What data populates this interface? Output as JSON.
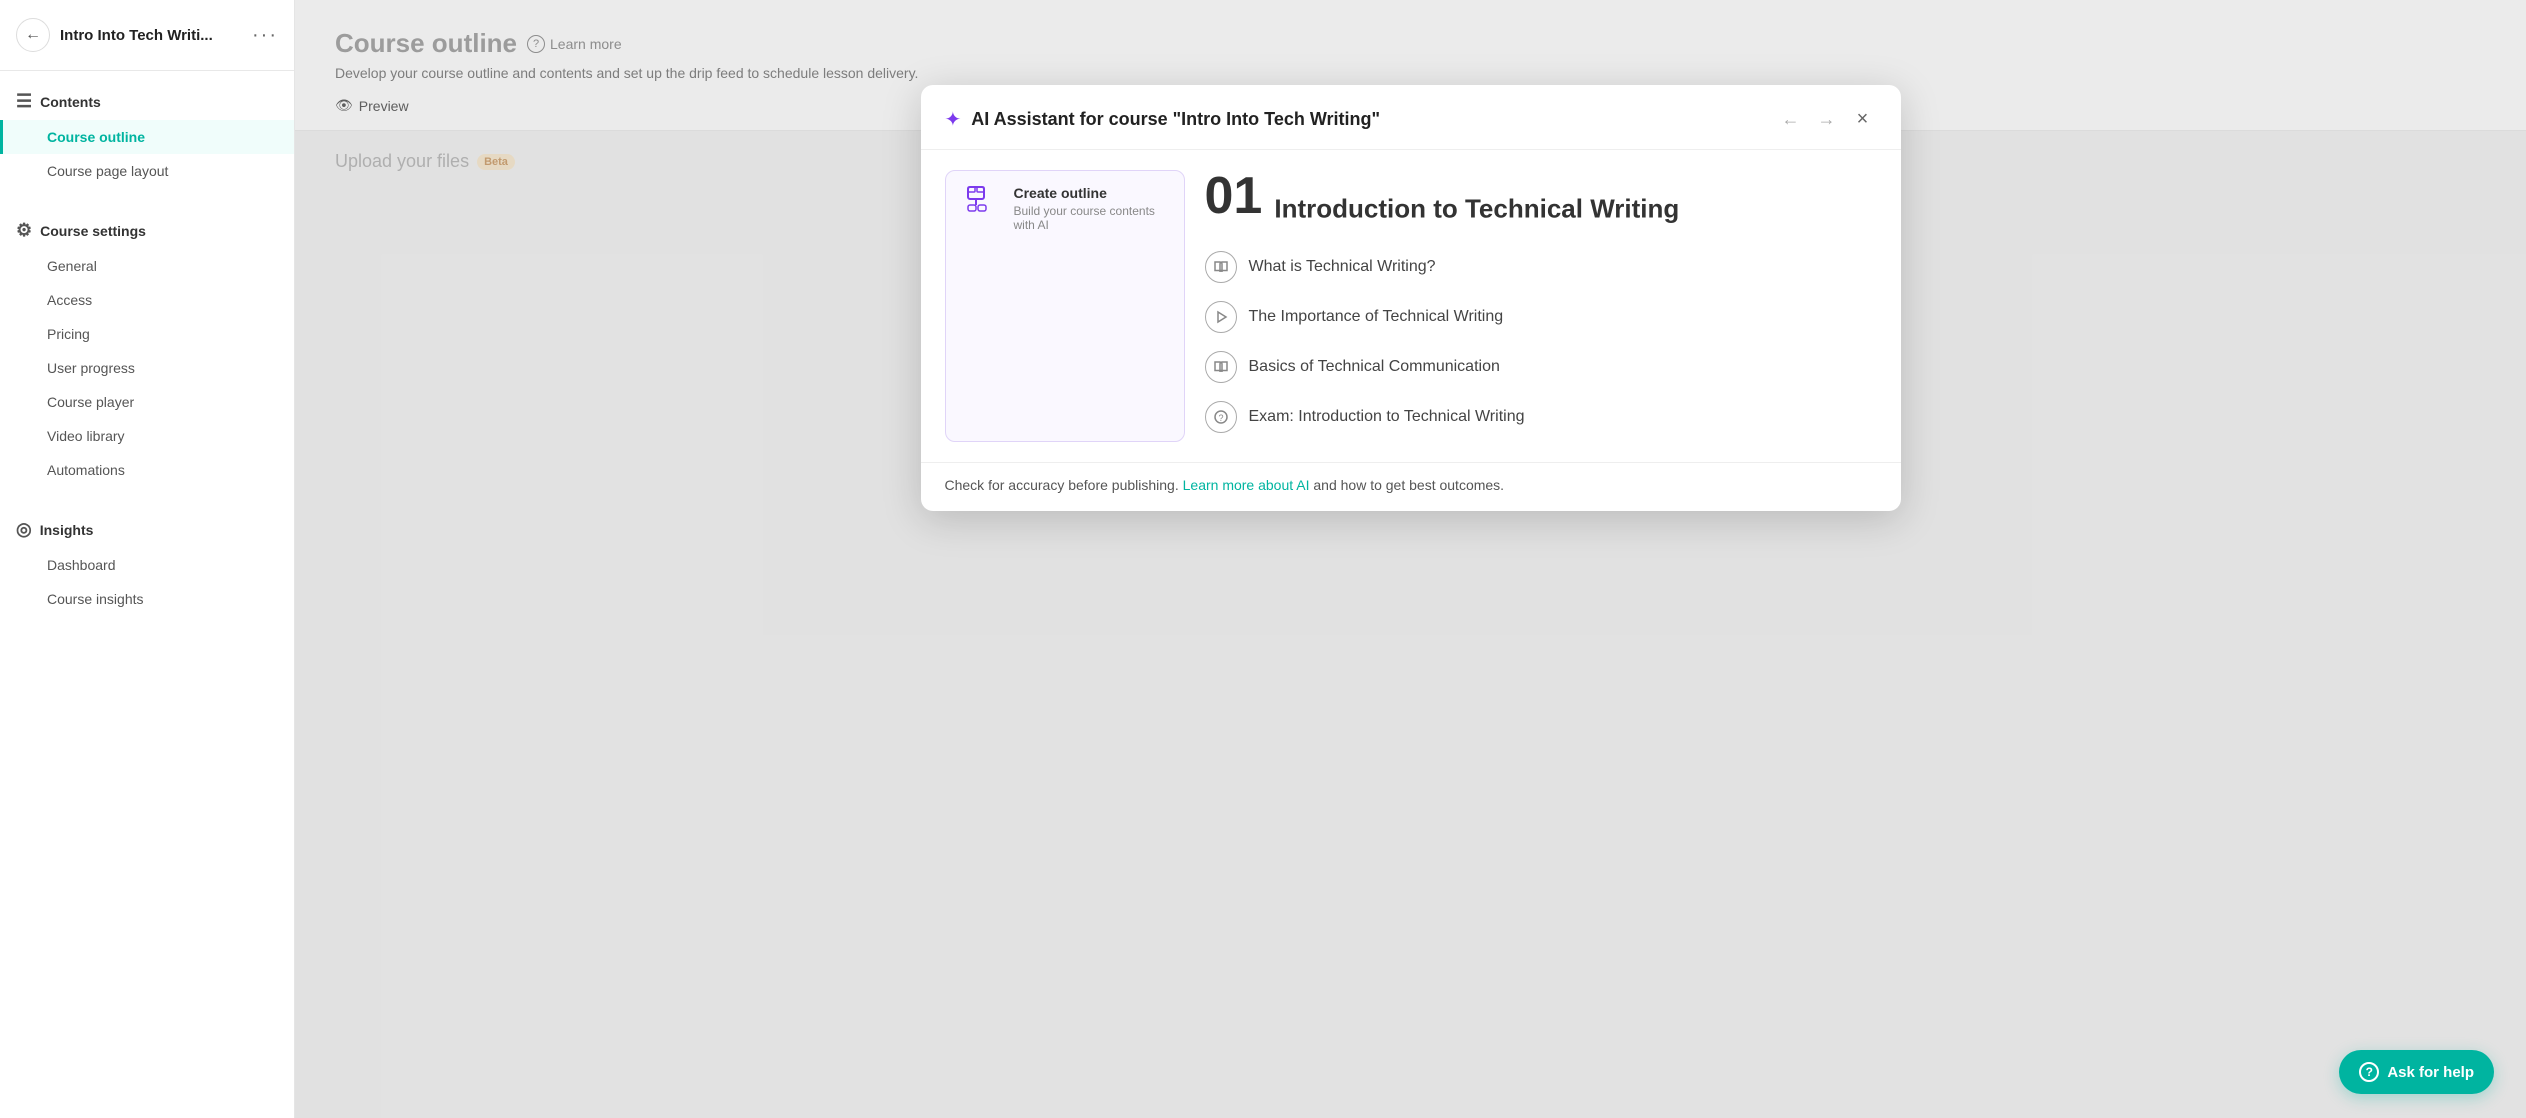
{
  "sidebar": {
    "header": {
      "back_label": "←",
      "title": "Intro Into Tech Writi...",
      "more_label": "···"
    },
    "sections": [
      {
        "id": "contents",
        "icon": "☰",
        "label": "Contents",
        "items": [
          {
            "id": "course-outline",
            "label": "Course outline",
            "active": true
          },
          {
            "id": "course-page-layout",
            "label": "Course page layout",
            "active": false
          }
        ]
      },
      {
        "id": "course-settings",
        "icon": "⚙",
        "label": "Course settings",
        "items": [
          {
            "id": "general",
            "label": "General",
            "active": false
          },
          {
            "id": "access",
            "label": "Access",
            "active": false
          },
          {
            "id": "pricing",
            "label": "Pricing",
            "active": false
          },
          {
            "id": "user-progress",
            "label": "User progress",
            "active": false
          },
          {
            "id": "course-player",
            "label": "Course player",
            "active": false
          },
          {
            "id": "video-library",
            "label": "Video library",
            "active": false
          },
          {
            "id": "automations",
            "label": "Automations",
            "active": false
          }
        ]
      },
      {
        "id": "insights",
        "icon": "◎",
        "label": "Insights",
        "items": [
          {
            "id": "dashboard",
            "label": "Dashboard",
            "active": false
          },
          {
            "id": "course-insights",
            "label": "Course insights",
            "active": false
          }
        ]
      }
    ]
  },
  "main": {
    "title": "Course outline",
    "learn_more": "Learn more",
    "subtitle": "Develop your course outline and contents and set up the drip feed to schedule lesson delivery.",
    "preview_label": "Preview"
  },
  "modal": {
    "title": "AI Assistant for course \"Intro Into Tech Writing\"",
    "back_label": "←",
    "forward_label": "→",
    "close_label": "×",
    "create_outline": {
      "title": "Create outline",
      "subtitle": "Build your course contents with AI"
    },
    "section_number": "01",
    "section_title": "Introduction to Technical Writing",
    "lessons": [
      {
        "id": "lesson-1",
        "icon": "book",
        "label": "What is Technical Writing?"
      },
      {
        "id": "lesson-2",
        "icon": "play",
        "label": "The Importance of Technical Writing"
      },
      {
        "id": "lesson-3",
        "icon": "book",
        "label": "Basics of Technical Communication"
      },
      {
        "id": "lesson-4",
        "icon": "quiz",
        "label": "Exam: Introduction to Technical Writing"
      }
    ],
    "footer_text_before": "Check for accuracy before publishing. ",
    "footer_link": "Learn more about AI",
    "footer_text_after": " and how to get best outcomes."
  },
  "bg_content": {
    "upload_title": "Upload your files",
    "beta_label": "Beta"
  },
  "help_button": {
    "label": "Ask for help",
    "icon": "?"
  }
}
